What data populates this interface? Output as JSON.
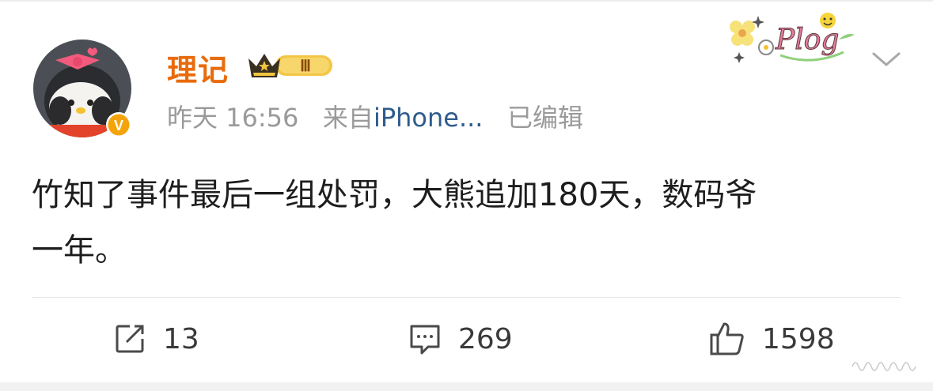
{
  "post": {
    "author": {
      "name": "理记",
      "membership_level_badge": "Ⅲ",
      "verified_badge": "V"
    },
    "meta": {
      "time": "昨天 16:56",
      "source_prefix": "来自",
      "source": "iPhone...",
      "edited": "已编辑"
    },
    "decoration_text": "Plog",
    "content_line1": "竹知了事件最后一组处罚，大熊追加180天，数码爷",
    "content_line2": "一年。"
  },
  "actions": {
    "repost_count": "13",
    "comment_count": "269",
    "like_count": "1598"
  },
  "icons": {
    "repost": "repost-icon",
    "comment": "comment-icon",
    "like": "thumbs-up-icon",
    "menu": "chevron-down-icon"
  },
  "colors": {
    "username": "#e86b0c",
    "meta": "#9a9a9a",
    "source_link": "#2f5b8c",
    "verified_badge": "#f5a30b"
  }
}
